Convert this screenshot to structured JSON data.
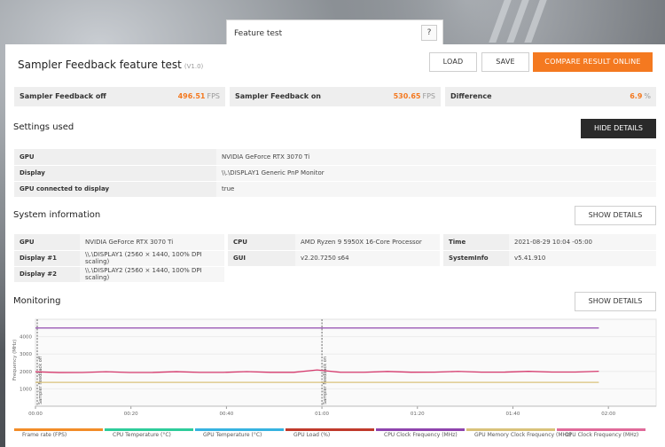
{
  "tab": {
    "label": "Feature test",
    "help": "?"
  },
  "header": {
    "title": "Sampler Feedback feature test",
    "version": "(V1.0)",
    "load": "LOAD",
    "save": "SAVE",
    "compare": "COMPARE RESULT ONLINE"
  },
  "results": [
    {
      "label": "Sampler Feedback off",
      "value": "496.51",
      "unit": "FPS"
    },
    {
      "label": "Sampler Feedback on",
      "value": "530.65",
      "unit": "FPS"
    },
    {
      "label": "Difference",
      "value": "6.9",
      "unit": "%"
    }
  ],
  "settings": {
    "title": "Settings used",
    "button": "HIDE DETAILS",
    "rows": [
      {
        "k": "GPU",
        "v": "NVIDIA GeForce RTX 3070 Ti"
      },
      {
        "k": "Display",
        "v": "\\\\.\\DISPLAY1 Generic PnP Monitor"
      },
      {
        "k": "GPU connected to display",
        "v": "true"
      }
    ]
  },
  "sysinfo": {
    "title": "System information",
    "button": "SHOW DETAILS",
    "col1": [
      {
        "k": "GPU",
        "v": "NVIDIA GeForce RTX 3070 Ti"
      },
      {
        "k": "Display #1",
        "v": "\\\\.\\DISPLAY1 (2560 × 1440, 100% DPI scaling)"
      },
      {
        "k": "Display #2",
        "v": "\\\\.\\DISPLAY2 (2560 × 1440, 100% DPI scaling)"
      }
    ],
    "col2": [
      {
        "k": "CPU",
        "v": "AMD Ryzen 9 5950X 16-Core Processor"
      },
      {
        "k": "GUI",
        "v": "v2.20.7250 s64"
      }
    ],
    "col3": [
      {
        "k": "Time",
        "v": "2021-08-29 10:04 -05:00"
      },
      {
        "k": "SystemInfo",
        "v": "v5.41.910"
      }
    ]
  },
  "monitoring": {
    "title": "Monitoring",
    "button": "SHOW DETAILS"
  },
  "chart_data": {
    "type": "line",
    "ylabel": "Frequency (MHz)",
    "ylim": [
      0,
      5000
    ],
    "yticks": [
      1000,
      2000,
      3000,
      4000
    ],
    "xticks": [
      "00:00",
      "00:20",
      "00:40",
      "01:00",
      "01:20",
      "01:40",
      "02:00"
    ],
    "markers": [
      {
        "t": 0,
        "label": "Sampler Feedback off"
      },
      {
        "t": 60,
        "label": "Sampler Feedback on"
      }
    ],
    "series": [
      {
        "name": "GPU Clock Frequency (MHz)",
        "color": "#9b59b6",
        "y0": 4500,
        "y1": 4500
      },
      {
        "name": "GPU Memory Clock Frequency (MHz)",
        "color": "#d9c27a",
        "y0": 1370,
        "y1": 1370
      },
      {
        "name": "CPU Clock Frequency (MHz)",
        "color": "#d63b6e",
        "y0": 1950,
        "y1": 1980
      }
    ],
    "legend": [
      {
        "name": "Frame rate (FPS)",
        "color": "#f28c28"
      },
      {
        "name": "CPU Temperature (°C)",
        "color": "#2ecc9b"
      },
      {
        "name": "GPU Temperature (°C)",
        "color": "#36b3e0"
      },
      {
        "name": "GPU Load (%)",
        "color": "#c0392b"
      },
      {
        "name": "CPU Clock Frequency (MHz)",
        "color": "#8e44ad"
      },
      {
        "name": "GPU Memory Clock Frequency (MHz)",
        "color": "#d9c27a"
      },
      {
        "name": "GPU Clock Frequency (MHz)",
        "color": "#e06a9a"
      }
    ]
  }
}
